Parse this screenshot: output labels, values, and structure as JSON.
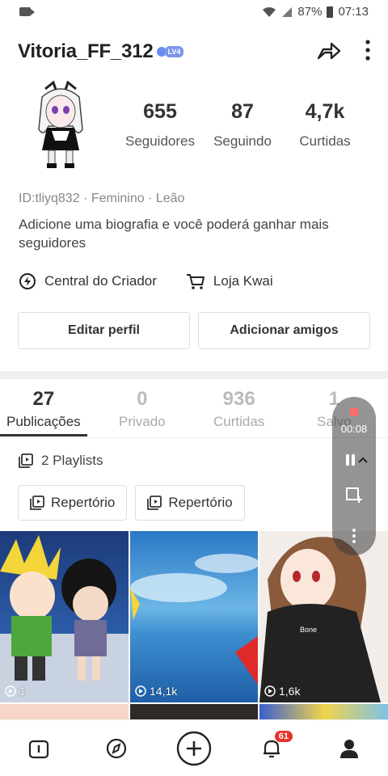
{
  "status": {
    "battery": "87%",
    "time": "07:13"
  },
  "profile": {
    "username": "Vitoria_FF_312",
    "level": "LV4",
    "stats": [
      {
        "value": "655",
        "label": "Seguidores"
      },
      {
        "value": "87",
        "label": "Seguindo"
      },
      {
        "value": "4,7k",
        "label": "Curtidas"
      }
    ],
    "meta": "ID:tliyq832 · Feminino · Leão",
    "bio": "Adicione uma biografia e você poderá ganhar mais seguidores",
    "links": {
      "creator": "Central do Criador",
      "shop": "Loja Kwai"
    },
    "buttons": {
      "edit": "Editar perfil",
      "add_friends": "Adicionar amigos"
    }
  },
  "tabs": [
    {
      "count": "27",
      "label": "Publicações"
    },
    {
      "count": "0",
      "label": "Privado"
    },
    {
      "count": "936",
      "label": "Curtidas"
    },
    {
      "count": "1",
      "label": "Salvo"
    }
  ],
  "playlists": {
    "title": "2 Playlists",
    "items": [
      "Repertório",
      "Repertório"
    ]
  },
  "grid": [
    {
      "views": "1"
    },
    {
      "views": "14,1k"
    },
    {
      "views": "1,6k"
    }
  ],
  "recorder": {
    "time": "00:08"
  },
  "bottom_nav": {
    "notifications": "61"
  },
  "colors": {
    "accent": "#e6332a",
    "level": "#7b96ec"
  }
}
